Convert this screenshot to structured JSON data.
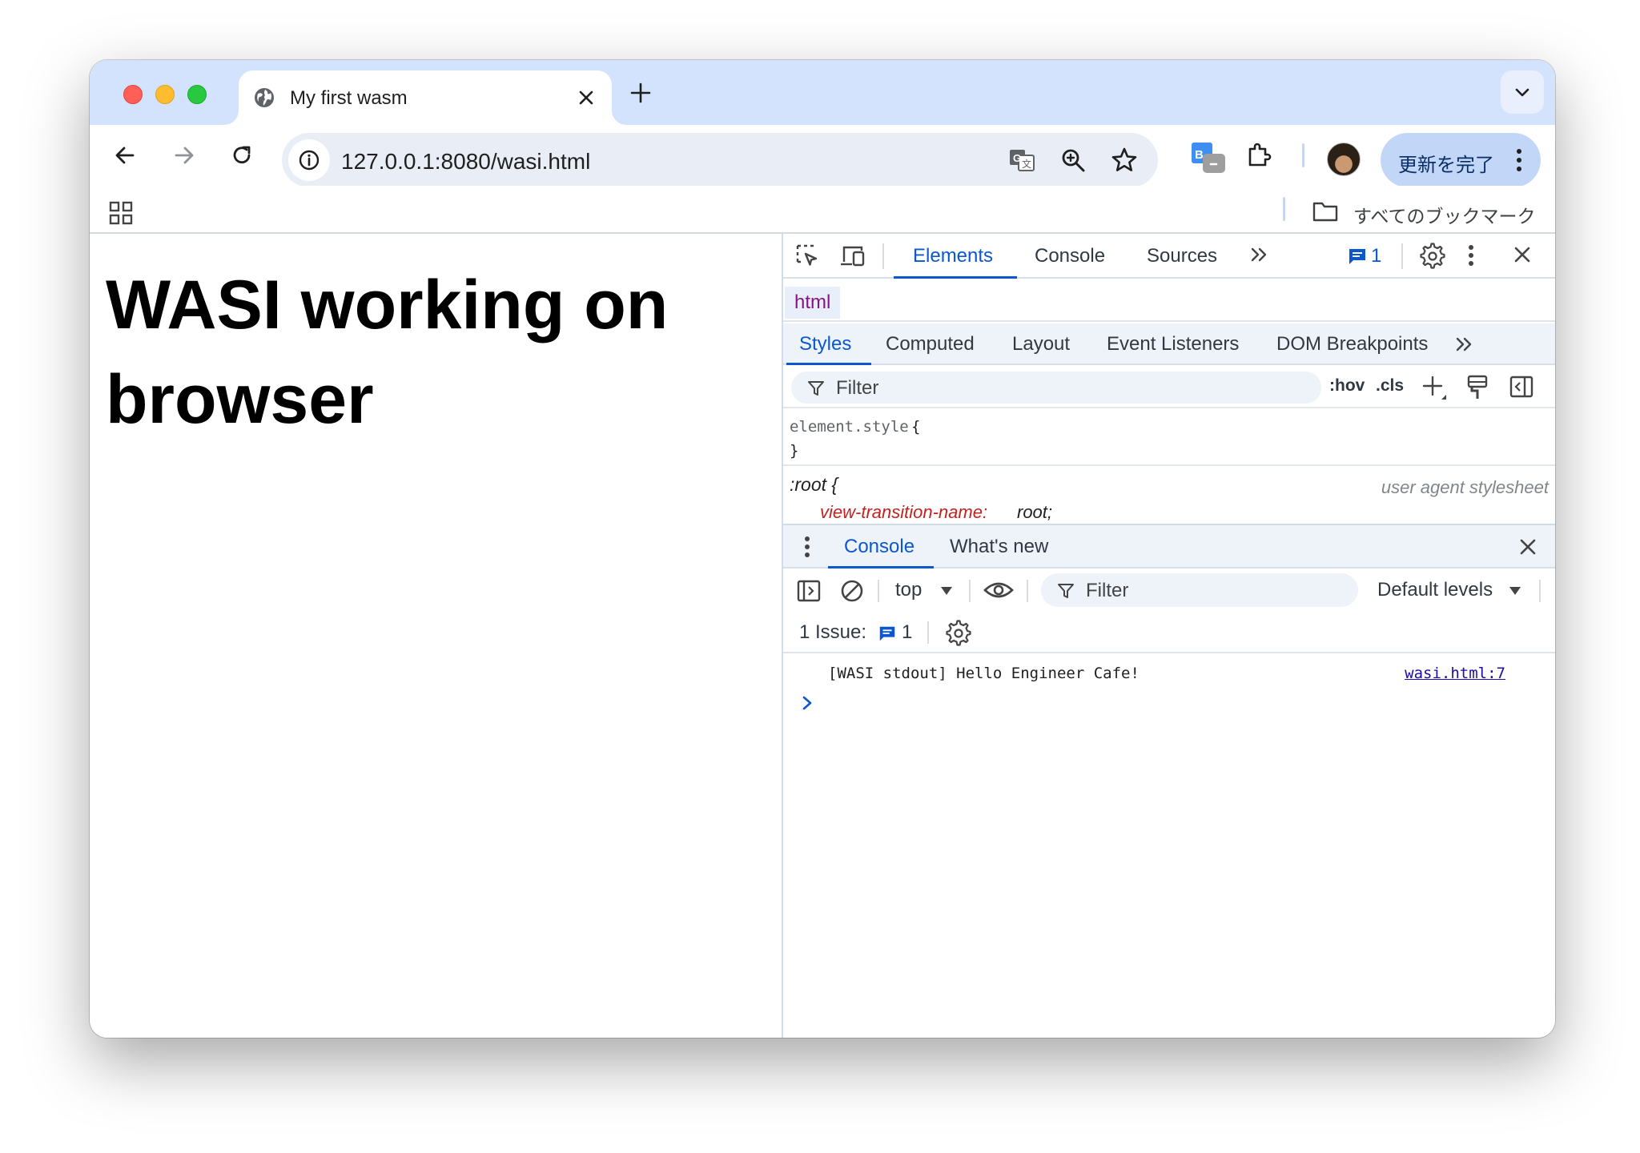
{
  "tab": {
    "title": "My first wasm"
  },
  "toolbar": {
    "url": "127.0.0.1:8080/wasi.html",
    "update_button": "更新を完了"
  },
  "bookmarks": {
    "all_bookmarks": "すべてのブックマーク"
  },
  "page": {
    "heading": "WASI working on browser"
  },
  "devtools": {
    "tabs": [
      "Elements",
      "Console",
      "Sources"
    ],
    "issue_badge_count": "1",
    "breadcrumb": "html",
    "styles_tabs": [
      "Styles",
      "Computed",
      "Layout",
      "Event Listeners",
      "DOM Breakpoints"
    ],
    "filter_placeholder": "Filter",
    "hov": ":hov",
    "cls": ".cls",
    "rule1": {
      "selector": "element.style",
      "open": "{",
      "close": "}"
    },
    "rule2": {
      "selector": ":root {",
      "source": "user agent stylesheet",
      "property": "view-transition-name:",
      "value": "root;"
    },
    "drawer_tabs": [
      "Console",
      "What's new"
    ],
    "console": {
      "context": "top",
      "filter_placeholder": "Filter",
      "levels": "Default levels",
      "issues_label": "1 Issue:",
      "issues_count": "1",
      "log_message": "[WASI stdout] Hello Engineer Cafe!",
      "log_source": "wasi.html:7"
    }
  },
  "colors": {
    "accent": "#0b57d0",
    "tabstrip": "#d3e3fd",
    "update_button": "#c2d7f7"
  }
}
